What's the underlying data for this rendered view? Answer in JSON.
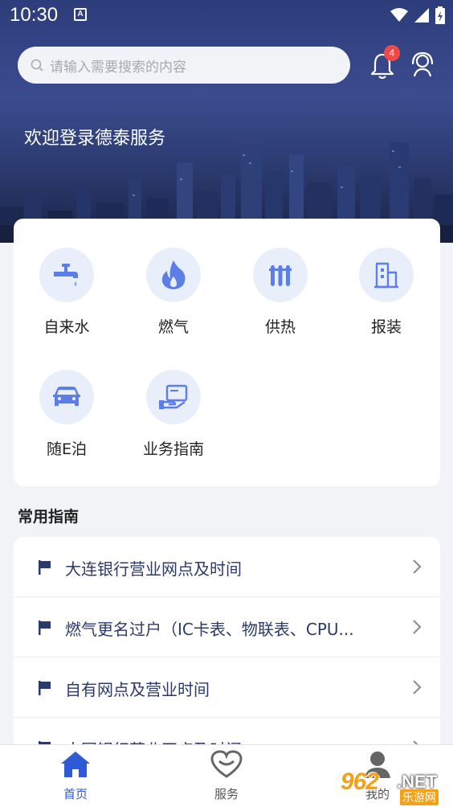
{
  "status_bar": {
    "time": "10:30",
    "notification_letter": "A"
  },
  "header": {
    "search_placeholder": "请输入需要搜索的内容",
    "notification_count": "4",
    "welcome": "欢迎登录德泰服务"
  },
  "services": [
    {
      "label": "自来水",
      "icon": "faucet-icon"
    },
    {
      "label": "燃气",
      "icon": "flame-icon"
    },
    {
      "label": "供热",
      "icon": "radiator-icon"
    },
    {
      "label": "报装",
      "icon": "building-icon"
    },
    {
      "label": "随E泊",
      "icon": "car-icon"
    },
    {
      "label": "业务指南",
      "icon": "guide-screen-icon"
    }
  ],
  "guides_section": {
    "title": "常用指南",
    "items": [
      "大连银行营业网点及时间",
      "燃气更名过户（IC卡表、物联表、CPU...",
      "自有网点及营业时间",
      "中国银行营业网点及时间"
    ]
  },
  "tabbar": {
    "home": "首页",
    "service": "服务",
    "mine": "我的"
  },
  "watermark": {
    "logo": "962",
    "suffix": ".NET",
    "sub": "乐游网"
  },
  "colors": {
    "accent": "#2f5ad6",
    "icon_blue": "#5b7fe6",
    "icon_bg": "#e9eefb",
    "badge": "#ee4a4a"
  }
}
